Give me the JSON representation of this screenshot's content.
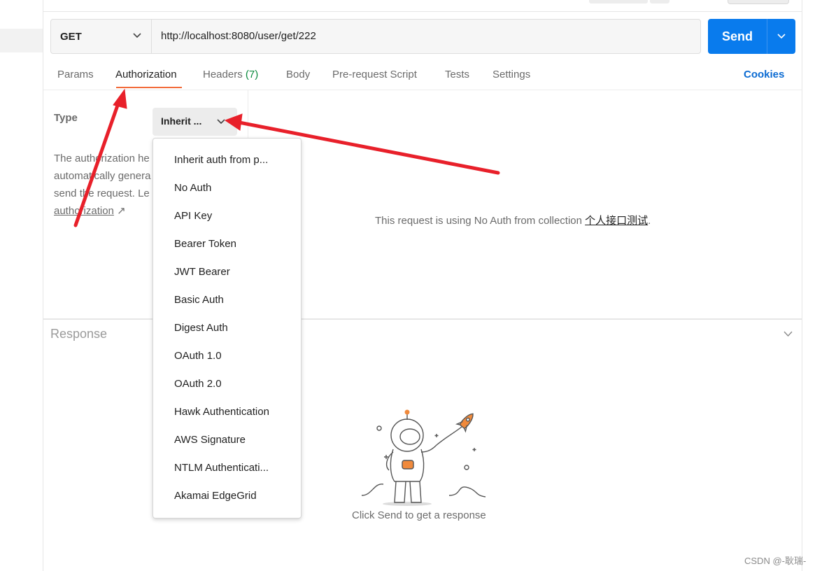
{
  "request": {
    "method": "GET",
    "url": "http://localhost:8080/user/get/222",
    "send_label": "Send"
  },
  "tabs": {
    "params": "Params",
    "authorization": "Authorization",
    "headers": "Headers",
    "headers_count": "(7)",
    "body": "Body",
    "pre_request": "Pre-request Script",
    "tests": "Tests",
    "settings": "Settings",
    "cookies": "Cookies"
  },
  "auth": {
    "type_label": "Type",
    "selected_type": "Inherit ...",
    "description_lines": [
      "The authorization he",
      "automatically genera",
      "send the request. Le"
    ],
    "learn_link": "authorization",
    "link_arrow": "↗",
    "status_prefix": "This request is using No Auth from collection",
    "collection_name": "个人接口测试",
    "status_suffix": "."
  },
  "auth_types": [
    "Inherit auth from p...",
    "No Auth",
    "API Key",
    "Bearer Token",
    "JWT Bearer",
    "Basic Auth",
    "Digest Auth",
    "OAuth 1.0",
    "OAuth 2.0",
    "Hawk Authentication",
    "AWS Signature",
    "NTLM Authenticati...",
    "Akamai EdgeGrid"
  ],
  "response": {
    "title": "Response",
    "hint": "Click Send to get a response"
  },
  "watermark": "CSDN @-耿瑞-",
  "icons": {
    "method_dropdown": "chevron-down-icon",
    "send_dropdown": "chevron-down-icon",
    "type_dropdown": "chevron-down-icon",
    "response_collapse": "chevron-down-icon",
    "illustration": "astronaut-rocket-illustration"
  },
  "colors": {
    "send_button": "#097bed",
    "active_tab_underline": "#f26b3a",
    "cookies_link": "#0b6bd2",
    "headers_count": "#0a8a3d",
    "annotation_arrows": "#e8202a"
  }
}
